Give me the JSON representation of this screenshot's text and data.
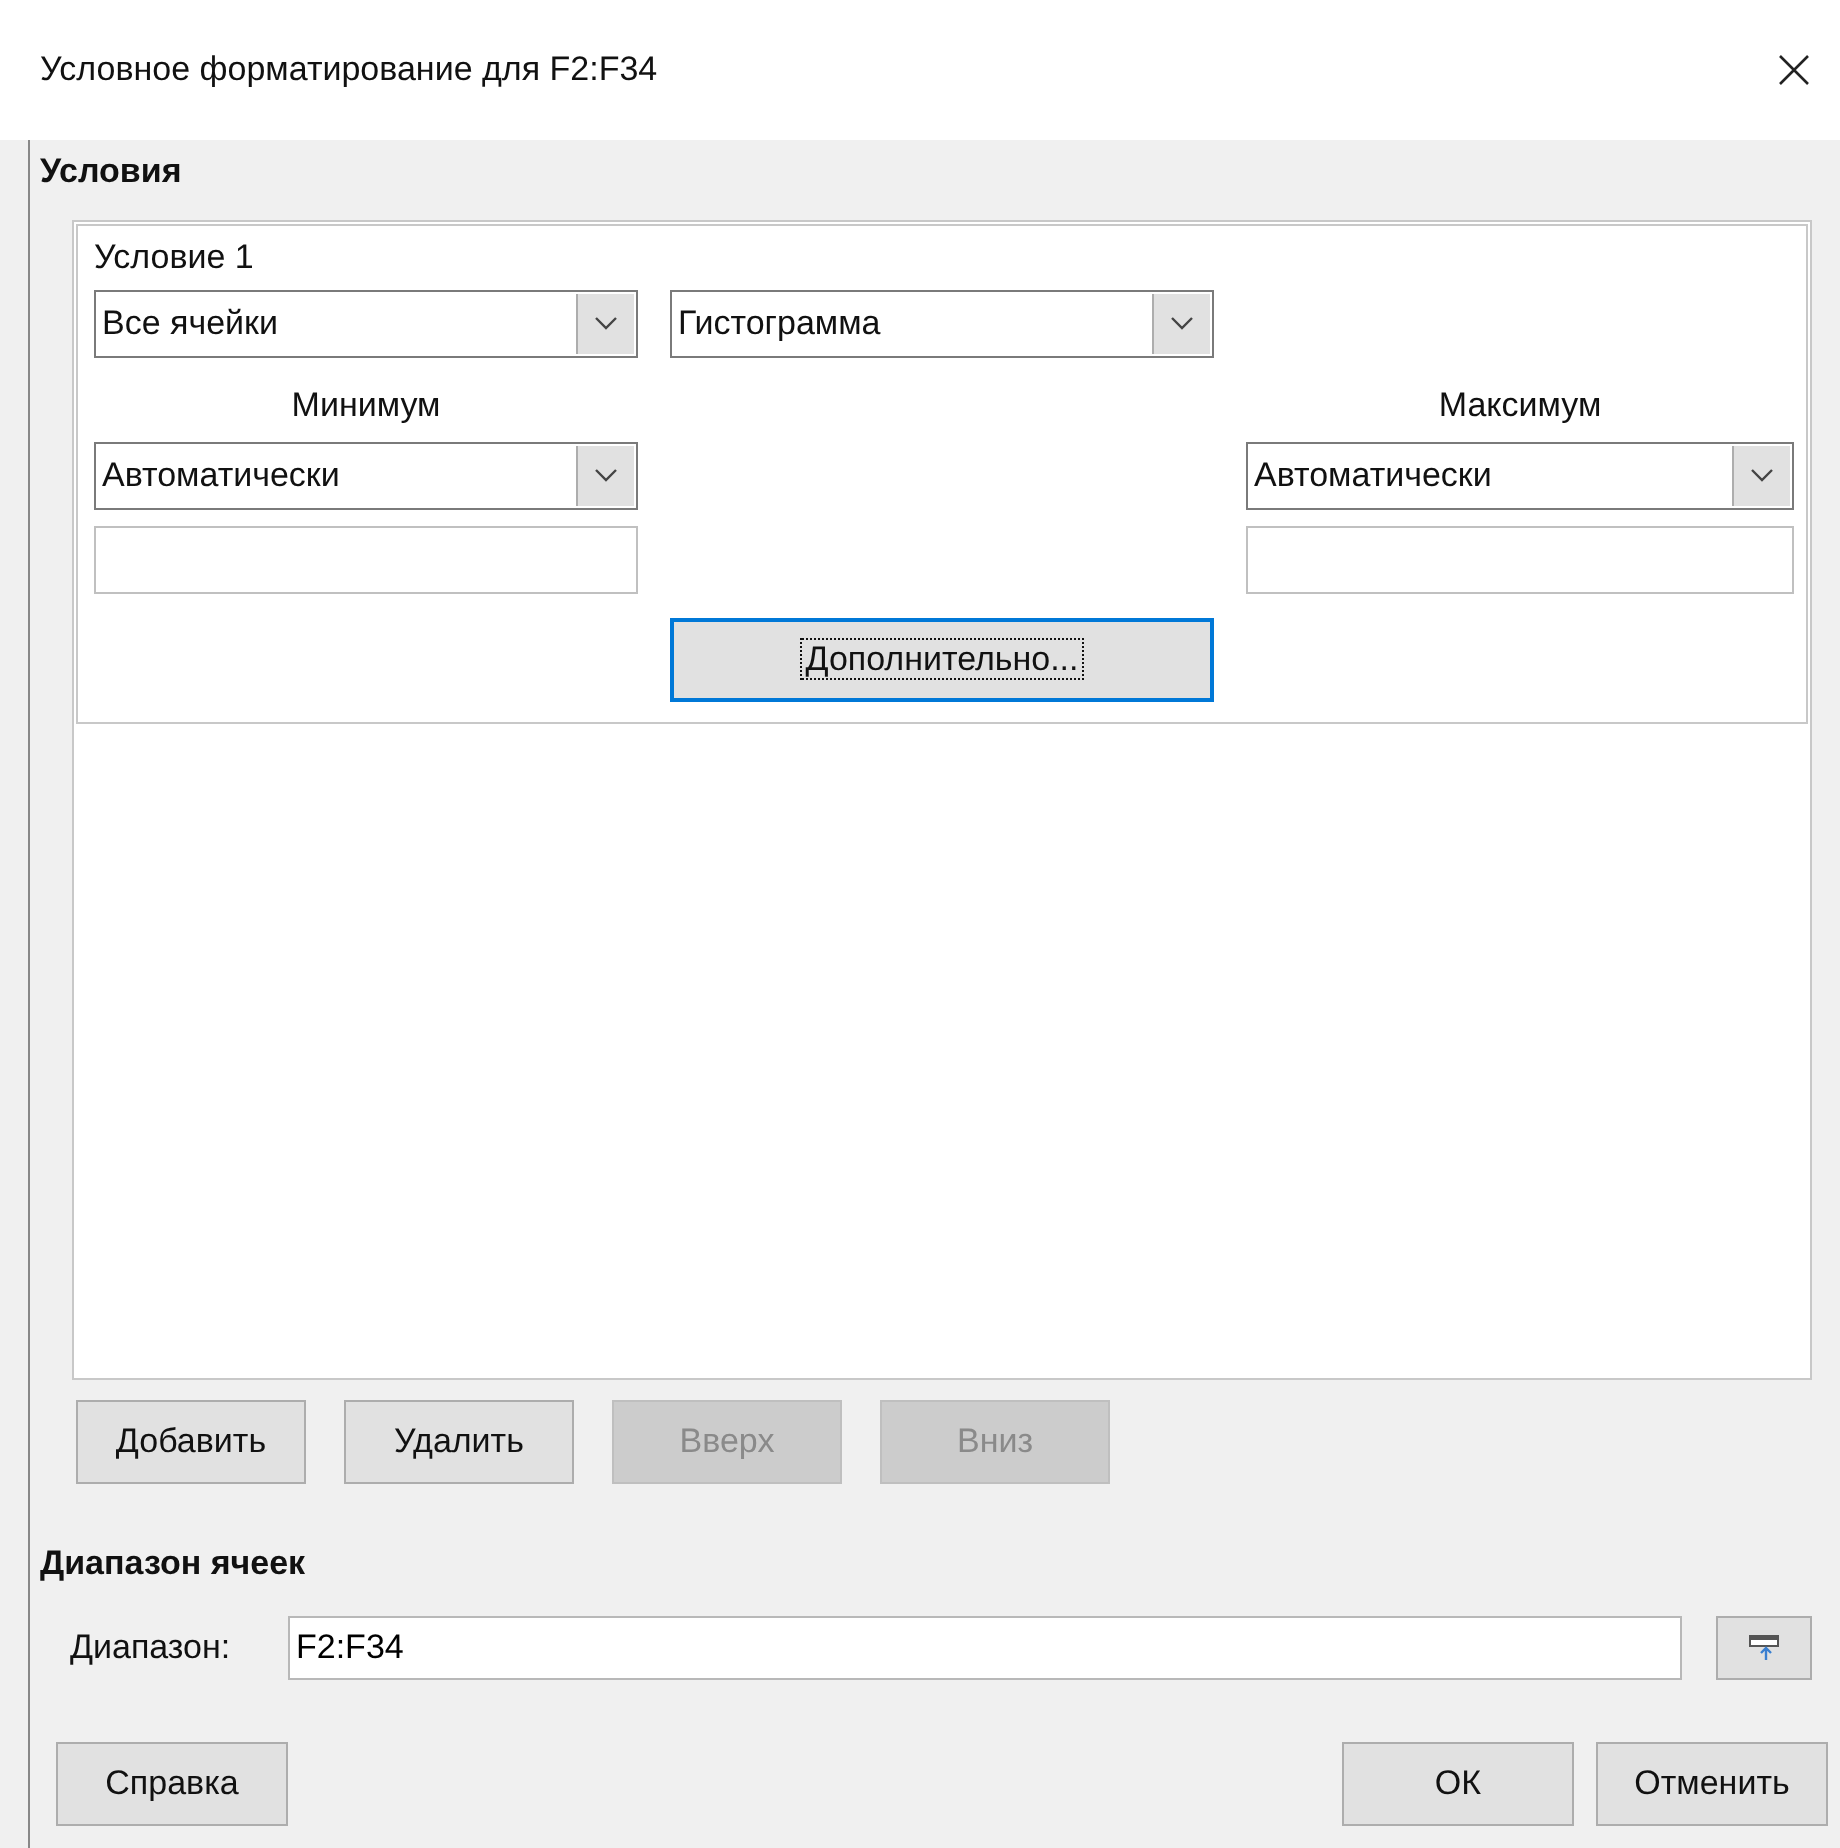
{
  "window": {
    "title": "Условное форматирование для F2:F34"
  },
  "conditions": {
    "heading": "Условия",
    "items": [
      {
        "title": "Условие 1",
        "scope": "Все ячейки",
        "style": "Гистограмма",
        "minimum": {
          "label": "Минимум",
          "type": "Автоматически"
        },
        "maximum": {
          "label": "Максимум",
          "type": "Автоматически"
        },
        "more_button": {
          "label": "Дополнительно...",
          "focused": true
        }
      }
    ]
  },
  "list_buttons": [
    {
      "label": "Добавить",
      "disabled": false
    },
    {
      "label": "Удалить",
      "disabled": false
    },
    {
      "label": "Вверх",
      "disabled": true
    },
    {
      "label": "Вниз",
      "disabled": true
    }
  ],
  "range": {
    "heading": "Диапазон ячеек",
    "label": "Диапазон:",
    "value": "F2:F34"
  },
  "help_button": {
    "label": "Справка"
  },
  "dialog_buttons": [
    {
      "label": "ОК"
    },
    {
      "label": "Отменить"
    }
  ]
}
